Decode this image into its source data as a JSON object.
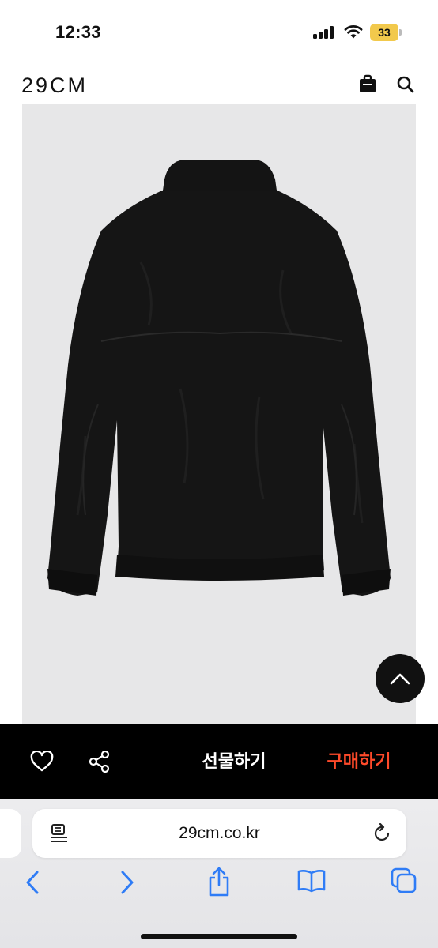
{
  "status_bar": {
    "time": "12:33",
    "battery": "33",
    "battery_color": "#f2c94c"
  },
  "header": {
    "logo": "29CM",
    "icons": [
      "bag-icon",
      "search-icon"
    ]
  },
  "product": {
    "image_background": "#e7e7e8",
    "image_subject": "black jacket back view",
    "scroll_top_icon": "chevron-up-icon"
  },
  "action_bar": {
    "background": "#000000",
    "like_icon": "heart-icon",
    "share_icon": "share-icon",
    "gift_label": "선물하기",
    "buy_label": "구매하기",
    "buy_color": "#ff4a2a"
  },
  "browser": {
    "url": "29cm.co.kr",
    "accent": "#2f7cf6",
    "toolbar_icons": [
      "back-icon",
      "forward-icon",
      "share-icon",
      "bookmarks-icon",
      "tabs-icon"
    ]
  }
}
